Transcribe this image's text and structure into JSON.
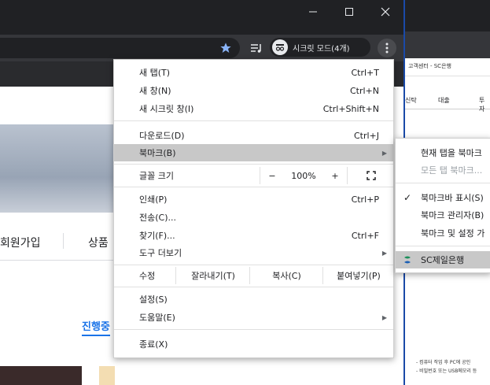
{
  "window_controls": {
    "minimize_icon": "minimize-icon",
    "maximize_icon": "maximize-icon",
    "close_icon": "close-icon"
  },
  "toolbar": {
    "bookmark_star_icon": "star-icon",
    "media_icon": "media-playlist-icon",
    "incognito_label": "시크릿 모드(4개)",
    "menu_icon": "kebab-menu-icon"
  },
  "page": {
    "nav_items": [
      "회원가입",
      "상품"
    ],
    "active_tab": "진행중"
  },
  "second_window": {
    "tab_title": "고객센터 - SC은행",
    "menu_items": [
      "신탁",
      "대출",
      "투자"
    ],
    "notice_lines": [
      "- 컴퓨터 작업 후 PC에 공인",
      "- 비밀번호 또는 USB메모리 등"
    ]
  },
  "menu": {
    "new_tab": {
      "label": "새 탭(T)",
      "shortcut": "Ctrl+T"
    },
    "new_window": {
      "label": "새 창(N)",
      "shortcut": "Ctrl+N"
    },
    "new_incognito": {
      "label": "새 시크릿 창(I)",
      "shortcut": "Ctrl+Shift+N"
    },
    "downloads": {
      "label": "다운로드(D)",
      "shortcut": "Ctrl+J"
    },
    "bookmarks": {
      "label": "북마크(B)"
    },
    "zoom": {
      "label": "글꼴 크기",
      "minus": "−",
      "value": "100%",
      "plus": "+"
    },
    "print": {
      "label": "인쇄(P)",
      "shortcut": "Ctrl+P"
    },
    "cast": {
      "label": "전송(C)..."
    },
    "find": {
      "label": "찾기(F)...",
      "shortcut": "Ctrl+F"
    },
    "more_tools": {
      "label": "도구 더보기"
    },
    "edit": {
      "label": "수정",
      "cut": "잘라내기(T)",
      "copy": "복사(C)",
      "paste": "붙여넣기(P)"
    },
    "settings": {
      "label": "설정(S)"
    },
    "help": {
      "label": "도움말(E)"
    },
    "exit": {
      "label": "종료(X)"
    }
  },
  "bookmark_submenu": {
    "bookmark_tab": "현재 탭을 북마크",
    "bookmark_all": "모든 탭 북마크...",
    "show_bar": "북마크바 표시(S)",
    "manager": "북마크 관리자(B)",
    "import": "북마크 및 설정 가",
    "sc_bank": "SC제일은행"
  }
}
